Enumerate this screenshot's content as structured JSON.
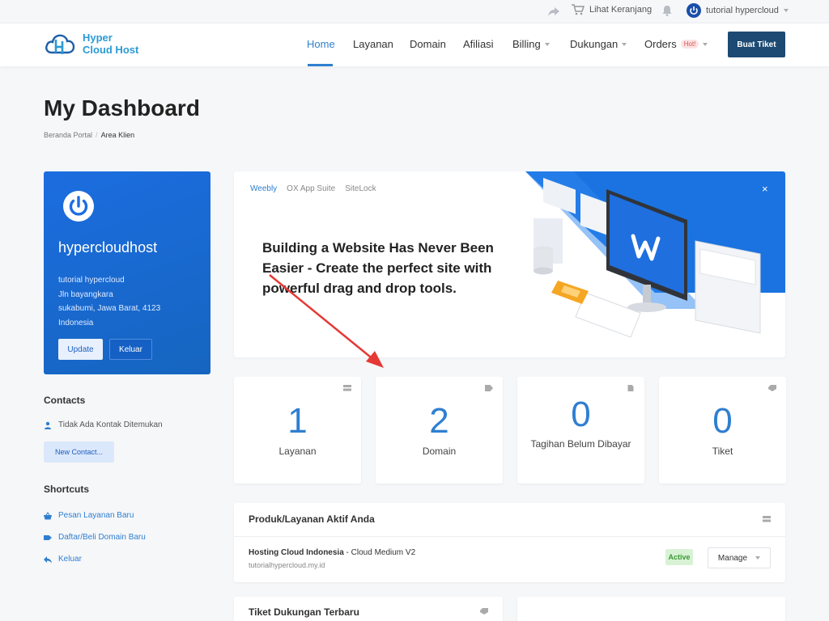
{
  "topbar": {
    "cart_label": "Lihat Keranjang",
    "user_label": "tutorial hypercloud"
  },
  "brand": {
    "line1": "Hyper",
    "line2": "Cloud Host"
  },
  "nav": {
    "items": [
      {
        "label": "Home",
        "active": true
      },
      {
        "label": "Layanan"
      },
      {
        "label": "Domain"
      },
      {
        "label": "Afiliasi"
      },
      {
        "label": "Billing",
        "dropdown": true
      },
      {
        "label": "Dukungan",
        "dropdown": true
      },
      {
        "label": "Orders",
        "dropdown": true,
        "badge": "Hot!"
      }
    ],
    "cta_label": "Buat Tiket"
  },
  "page": {
    "title": "My Dashboard",
    "breadcrumb": [
      "Beranda Portal",
      "Area Klien"
    ]
  },
  "client": {
    "name": "hypercloudhost",
    "address_lines": [
      "tutorial hypercloud",
      "Jln bayangkara",
      "sukabumi, Jawa Barat, 4123",
      "Indonesia"
    ],
    "update_label": "Update",
    "logout_label": "Keluar"
  },
  "contacts": {
    "heading": "Contacts",
    "empty_text": "Tidak Ada Kontak Ditemukan",
    "new_label": "New Contact..."
  },
  "shortcuts": {
    "heading": "Shortcuts",
    "items": [
      "Pesan Layanan Baru",
      "Daftar/Beli Domain Baru",
      "Keluar"
    ]
  },
  "promo": {
    "tabs": [
      "Weebly",
      "OX App Suite",
      "SiteLock"
    ],
    "headline": "Building a Website Has Never Been Easier - Create the perfect site with powerful drag and drop tools.",
    "close": "×"
  },
  "stats": [
    {
      "value": "1",
      "label": "Layanan"
    },
    {
      "value": "2",
      "label": "Domain"
    },
    {
      "value": "0",
      "label": "Tagihan Belum Dibayar"
    },
    {
      "value": "0",
      "label": "Tiket"
    }
  ],
  "products": {
    "heading": "Produk/Layanan Aktif Anda",
    "item": {
      "name": "Hosting Cloud Indonesia",
      "plan": " - Cloud Medium V2",
      "domain": "tutorialhypercloud.my.id",
      "status": "Active",
      "manage_label": "Manage"
    }
  },
  "tickets": {
    "heading": "Tiket Dukungan Terbaru"
  },
  "colors": {
    "accent": "#2f7fd0",
    "navy": "#1c4a72",
    "card_blue": "#1c6de0",
    "arrow": "#e53935"
  }
}
